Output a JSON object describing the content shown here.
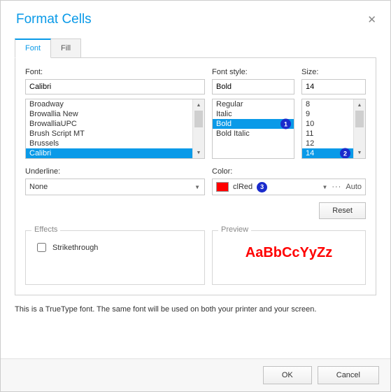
{
  "title": "Format Cells",
  "tabs": {
    "font": "Font",
    "fill": "Fill"
  },
  "font": {
    "label": "Font:",
    "value": "Calibri",
    "list": [
      "Broadway",
      "Browallia New",
      "BrowalliaUPC",
      "Brush Script MT",
      "Brussels",
      "Calibri"
    ],
    "selected": "Calibri"
  },
  "style": {
    "label": "Font style:",
    "value": "Bold",
    "list": [
      "Regular",
      "Italic",
      "Bold",
      "Bold Italic"
    ],
    "selected": "Bold"
  },
  "size": {
    "label": "Size:",
    "value": "14",
    "list": [
      "8",
      "9",
      "10",
      "11",
      "12",
      "14"
    ],
    "selected": "14"
  },
  "underline": {
    "label": "Underline:",
    "value": "None"
  },
  "color": {
    "label": "Color:",
    "name": "clRed",
    "hex": "#ff0000",
    "auto": "Auto"
  },
  "reset": "Reset",
  "effects": {
    "title": "Effects",
    "strike": "Strikethrough"
  },
  "preview": {
    "title": "Preview",
    "sample": "AaBbCcYyZz"
  },
  "footnote": "This is a TrueType font. The same font will be used on both your printer and your screen.",
  "buttons": {
    "ok": "OK",
    "cancel": "Cancel"
  },
  "badges": {
    "b1": "1",
    "b2": "2",
    "b3": "3"
  }
}
